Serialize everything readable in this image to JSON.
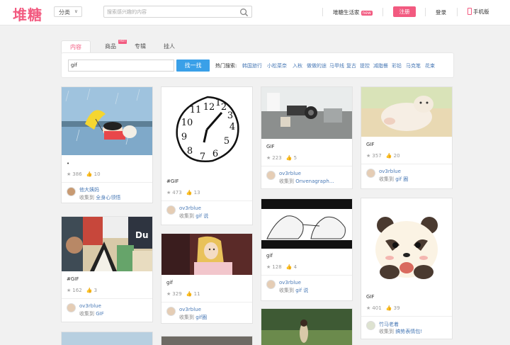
{
  "header": {
    "logo": "堆糖",
    "category_label": "分类",
    "search_placeholder": "搜索感兴趣的内容",
    "life_label": "堆糖生活家",
    "new_badge": "new",
    "register_label": "注册",
    "login_label": "登录",
    "mobile_label": "手机版"
  },
  "tabs": [
    {
      "label": "内容",
      "active": true
    },
    {
      "label": "商品",
      "badge": "HOT"
    },
    {
      "label": "专辑"
    },
    {
      "label": "挂人"
    }
  ],
  "search_panel": {
    "query": "gif",
    "button_label": "找一找",
    "hot_label": "热门搜索:",
    "hot_words": [
      "韩国旅行",
      "小松菜奈",
      "入秋",
      "做做的途",
      "马甲线",
      "复古",
      "提控",
      "减脂餐",
      "彩铅",
      "马克笔",
      "花束"
    ]
  },
  "cards": [
    {
      "title": "•",
      "likes": "386",
      "thumbs": "10",
      "user": "他大姨妈",
      "collected_to_label": "收集到",
      "collection": "全身心领悟"
    },
    {
      "title": "#GIF",
      "likes": "473",
      "thumbs": "13",
      "user": "ov3rblue",
      "collected_to_label": "收集到",
      "collection": "gif 说"
    },
    {
      "title": "GIF",
      "likes": "223",
      "thumbs": "5",
      "user": "ov3rblue",
      "collected_to_label": "收集到",
      "collection": "Onvenagraph..."
    },
    {
      "title": "GIF",
      "likes": "357",
      "thumbs": "20",
      "user": "ov3rblue",
      "collected_to_label": "收集到",
      "collection": "gif 圈"
    },
    {
      "title": "#GIF",
      "likes": "162",
      "thumbs": "3",
      "user": "ov3rblue",
      "collected_to_label": "收集到",
      "collection": "GIF"
    },
    {
      "title": "gif",
      "likes": "329",
      "thumbs": "11",
      "user": "ov3rblue",
      "collected_to_label": "收集到",
      "collection": "gif圈"
    },
    {
      "title": "gif",
      "likes": "128",
      "thumbs": "4",
      "user": "ov3rblue",
      "collected_to_label": "收集到",
      "collection": "gif 说"
    },
    {
      "title": "GIF",
      "likes": "401",
      "thumbs": "39",
      "user": "竹马老着",
      "collected_to_label": "收集到",
      "collection": "搞势表情包!"
    }
  ],
  "colors": {
    "brand": "#f25a80",
    "button_blue": "#3aa0e8",
    "link_blue": "#4a7ab6"
  }
}
